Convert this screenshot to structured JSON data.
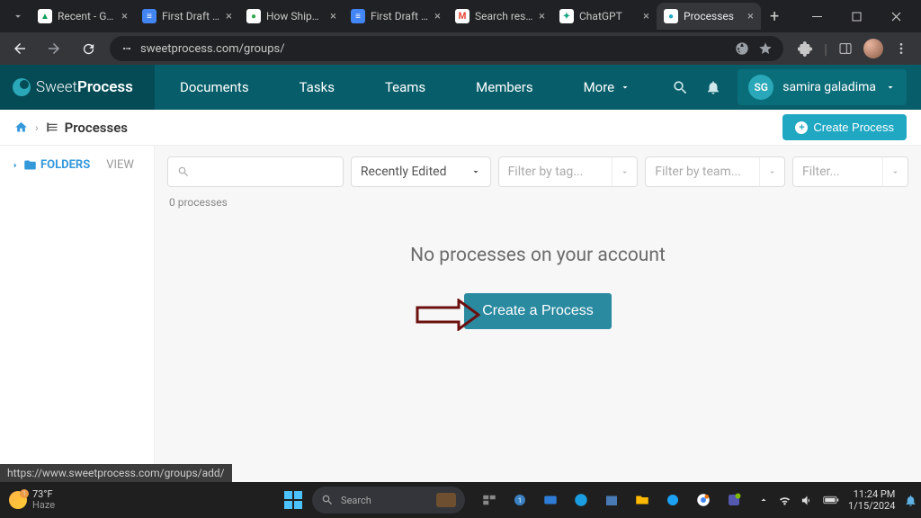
{
  "browser": {
    "tabs": [
      {
        "title": "Recent - Goo",
        "favicon_bg": "#0f9d58",
        "favicon_txt": "▲"
      },
      {
        "title": "First Draft for",
        "favicon_bg": "#4285f4",
        "favicon_txt": "≡"
      },
      {
        "title": "How ShipCalm",
        "favicon_bg": "#34a853",
        "favicon_txt": "●"
      },
      {
        "title": "First Draft for",
        "favicon_bg": "#4285f4",
        "favicon_txt": "≡"
      },
      {
        "title": "Search results",
        "favicon_bg": "#ea4335",
        "favicon_txt": "M"
      },
      {
        "title": "ChatGPT",
        "favicon_bg": "#10a37f",
        "favicon_txt": "✦"
      },
      {
        "title": "Processes",
        "favicon_bg": "#20a8c3",
        "favicon_txt": "●",
        "active": true
      }
    ],
    "url": "sweetprocess.com/groups/",
    "status_url": "https://www.sweetprocess.com/groups/add/"
  },
  "app": {
    "logo": {
      "light": "Sweet",
      "bold": "Process"
    },
    "nav": {
      "documents": "Documents",
      "tasks": "Tasks",
      "teams": "Teams",
      "members": "Members",
      "more": "More"
    },
    "user": {
      "initials": "SG",
      "name": "samira galadima"
    }
  },
  "breadcrumb": {
    "title": "Processes",
    "create_btn": "Create Process"
  },
  "sidebar": {
    "folders": "FOLDERS",
    "view": "VIEW"
  },
  "filters": {
    "sort_value": "Recently Edited",
    "tag_placeholder": "Filter by tag...",
    "team_placeholder": "Filter by team...",
    "last_placeholder": "Filter..."
  },
  "content": {
    "count": "0 processes",
    "empty_title": "No processes on your account",
    "create_btn": "Create a Process"
  },
  "taskbar": {
    "temp": "73°F",
    "cond": "Haze",
    "search_placeholder": "Search",
    "time": "11:24 PM",
    "date": "1/15/2024"
  }
}
